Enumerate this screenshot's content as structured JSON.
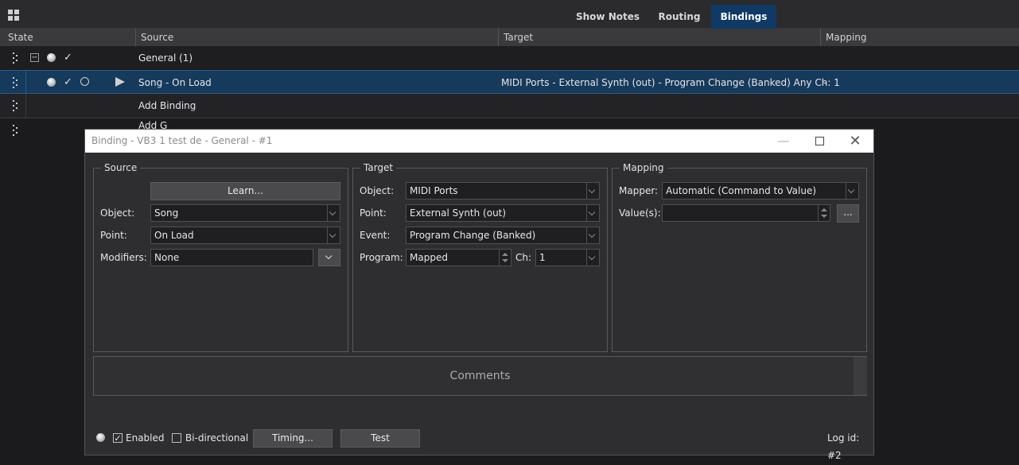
{
  "toolbar": {
    "icon": "grid-icon",
    "tabs": [
      {
        "label": "Show Notes"
      },
      {
        "label": "Routing"
      },
      {
        "label": "Bindings",
        "active": true
      }
    ]
  },
  "columns": [
    "State",
    "Source",
    "Target",
    "Mapping"
  ],
  "rows": {
    "group": {
      "source": "General (1)"
    },
    "binding": {
      "source": "Song - On Load",
      "target": "MIDI Ports - External Synth (out) - Program Change (Banked) Any Ch: 1",
      "mapping": "-"
    },
    "add_binding": {
      "source": "Add Binding"
    },
    "add_group_partial": {
      "source": "Add G"
    }
  },
  "dialog": {
    "title": "Binding - VB3 1 test de - General - #1",
    "source": {
      "legend": "Source",
      "learn_label": "Learn...",
      "object_label": "Object:",
      "object_value": "Song",
      "point_label": "Point:",
      "point_value": "On Load",
      "modifiers_label": "Modifiers:",
      "modifiers_value": "None"
    },
    "target": {
      "legend": "Target",
      "object_label": "Object:",
      "object_value": "MIDI Ports",
      "point_label": "Point:",
      "point_value": "External Synth (out)",
      "event_label": "Event:",
      "event_value": "Program Change (Banked)",
      "program_label": "Program:",
      "program_value": "Mapped",
      "ch_label": "Ch:",
      "ch_value": "1"
    },
    "mapping": {
      "legend": "Mapping",
      "mapper_label": "Mapper:",
      "mapper_value": "Automatic (Command to Value)",
      "values_label": "Value(s):",
      "values_value": "",
      "browse_label": "..."
    },
    "comments_placeholder": "Comments",
    "footer": {
      "enabled_label": "Enabled",
      "enabled_checked": true,
      "bidirectional_label": "Bi-directional",
      "bidirectional_checked": false,
      "timing_label": "Timing...",
      "test_label": "Test",
      "log_id": "Log id: #2"
    }
  },
  "colors": {
    "accent": "#0f3a66",
    "selected_row": "#163a5c"
  }
}
